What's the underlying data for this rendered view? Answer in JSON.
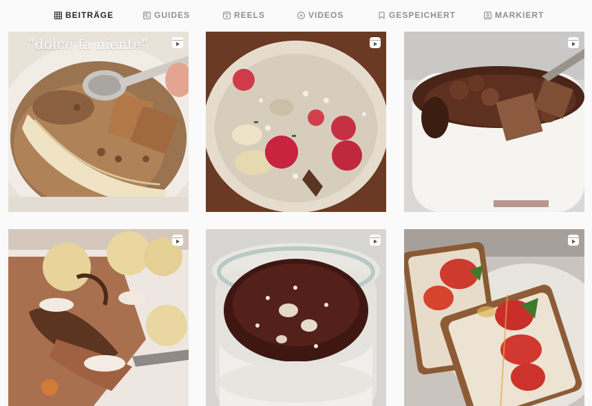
{
  "tabs": [
    {
      "label": "BEITRÄGE",
      "icon": "grid-icon",
      "active": true
    },
    {
      "label": "GUIDES",
      "icon": "guides-icon",
      "active": false
    },
    {
      "label": "REELS",
      "icon": "reels-icon",
      "active": false
    },
    {
      "label": "VIDEOS",
      "icon": "play-icon",
      "active": false
    },
    {
      "label": "GESPEICHERT",
      "icon": "bookmark-icon",
      "active": false
    },
    {
      "label": "MARKIERT",
      "icon": "tagged-icon",
      "active": false
    }
  ],
  "colors": {
    "active_tab": "#262626",
    "inactive_tab": "#8e8e8e",
    "background": "#fafafa"
  },
  "posts": [
    {
      "caption": "“dolce fa niente”",
      "reel_icon": "reel-icon",
      "subject": "oatmeal with banana, chocolate and spoon"
    },
    {
      "caption": "",
      "reel_icon": "reel-icon",
      "subject": "oatmeal with raspberries, coconut and nuts"
    },
    {
      "caption": "",
      "reel_icon": "reel-icon",
      "subject": "chocolate oats in white mug"
    },
    {
      "caption": "",
      "reel_icon": "reel-icon",
      "subject": "baked oats with banana slices"
    },
    {
      "caption": "",
      "reel_icon": "reel-icon",
      "subject": "chocolate pudding in glass jar"
    },
    {
      "caption": "",
      "reel_icon": "reel-icon",
      "subject": "toast with strawberries and honey"
    }
  ]
}
